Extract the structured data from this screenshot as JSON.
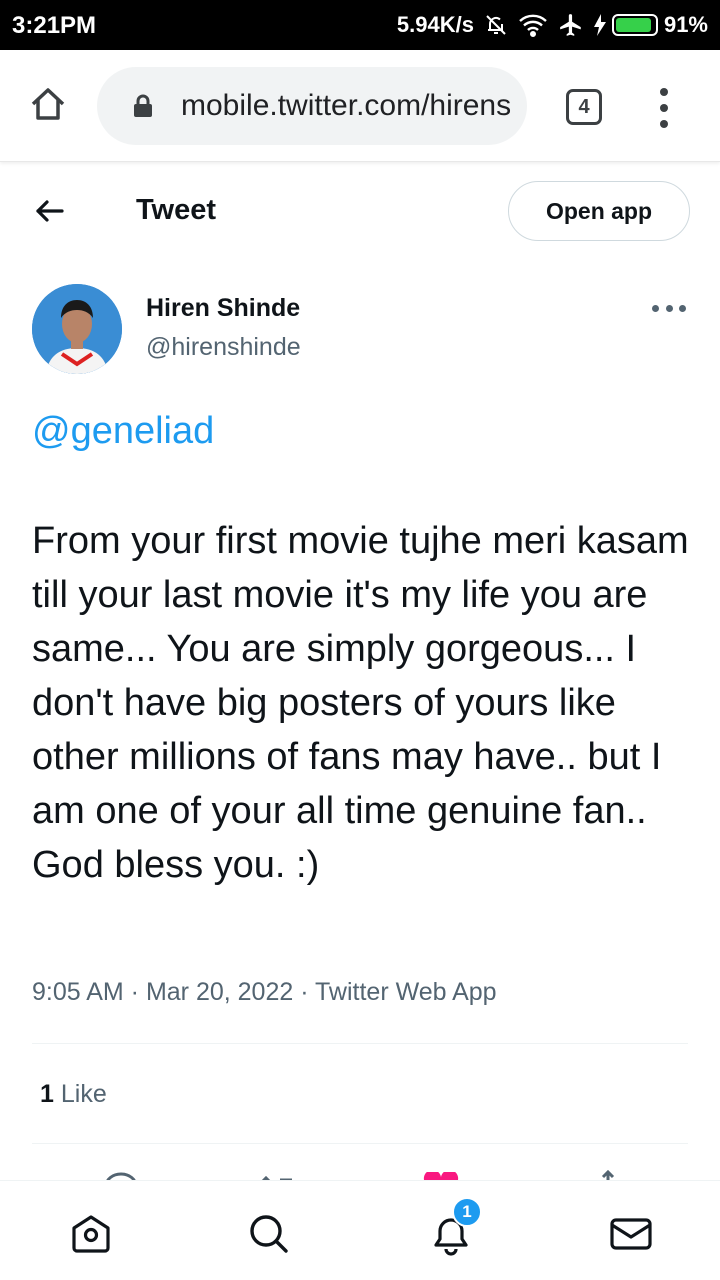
{
  "status_bar": {
    "time": "3:21PM",
    "network_speed": "5.94K/s",
    "battery_percent": "91%",
    "battery_level": 0.91,
    "icons": [
      "mute-bell-icon",
      "wifi-icon",
      "airplane-icon",
      "charging-icon",
      "battery-icon"
    ]
  },
  "browser": {
    "url": "mobile.twitter.com/hirenshinde",
    "tab_count": "4"
  },
  "header": {
    "title": "Tweet",
    "open_app_label": "Open app"
  },
  "tweet": {
    "author_name": "Hiren Shinde",
    "author_handle": "@hirenshinde",
    "mention": "@geneliad",
    "text": "From your first movie tujhe meri kasam till your last movie it's my life you are same... You are simply gorgeous... I don't have big posters of yours like other millions of fans may have.. but I am one of your all time genuine fan.. God bless you. :)",
    "meta": "9:05 AM · Mar 20, 2022 · Twitter Web App",
    "like_count": "1",
    "like_label": "Like"
  },
  "bottom_nav": {
    "items": [
      "home-icon",
      "search-icon",
      "notifications-icon",
      "messages-icon"
    ],
    "notification_badge": "1"
  },
  "colors": {
    "accent": "#1d9bf0",
    "text_primary": "#0f1419",
    "text_secondary": "#536471",
    "like_heart": "#f91880"
  }
}
